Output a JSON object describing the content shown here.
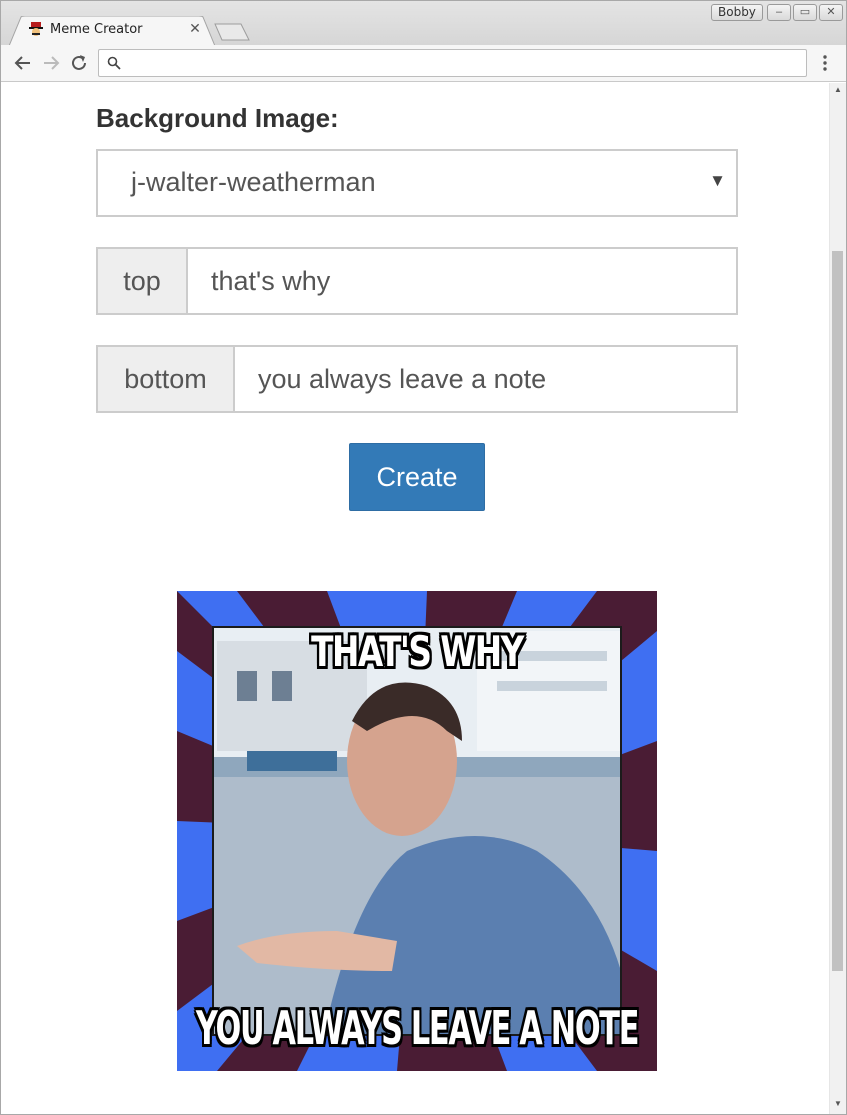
{
  "browser": {
    "tab_title": "Meme Creator",
    "profile_name": "Bobby",
    "url": ""
  },
  "form": {
    "background_label": "Background Image:",
    "background_selected": "j-walter-weatherman",
    "top_label": "top",
    "top_value": "that's why",
    "bottom_label": "bottom",
    "bottom_value": "you always leave a note",
    "create_label": "Create"
  },
  "meme": {
    "top_text": "THAT'S WHY",
    "bottom_text": "YOU ALWAYS LEAVE A NOTE",
    "colors": {
      "ray_blue": "#3f6ff2",
      "ray_maroon": "#4a1c34"
    }
  },
  "colors": {
    "primary_button": "#337ab7",
    "addon_bg": "#eeeeee",
    "border": "#cccccc"
  }
}
